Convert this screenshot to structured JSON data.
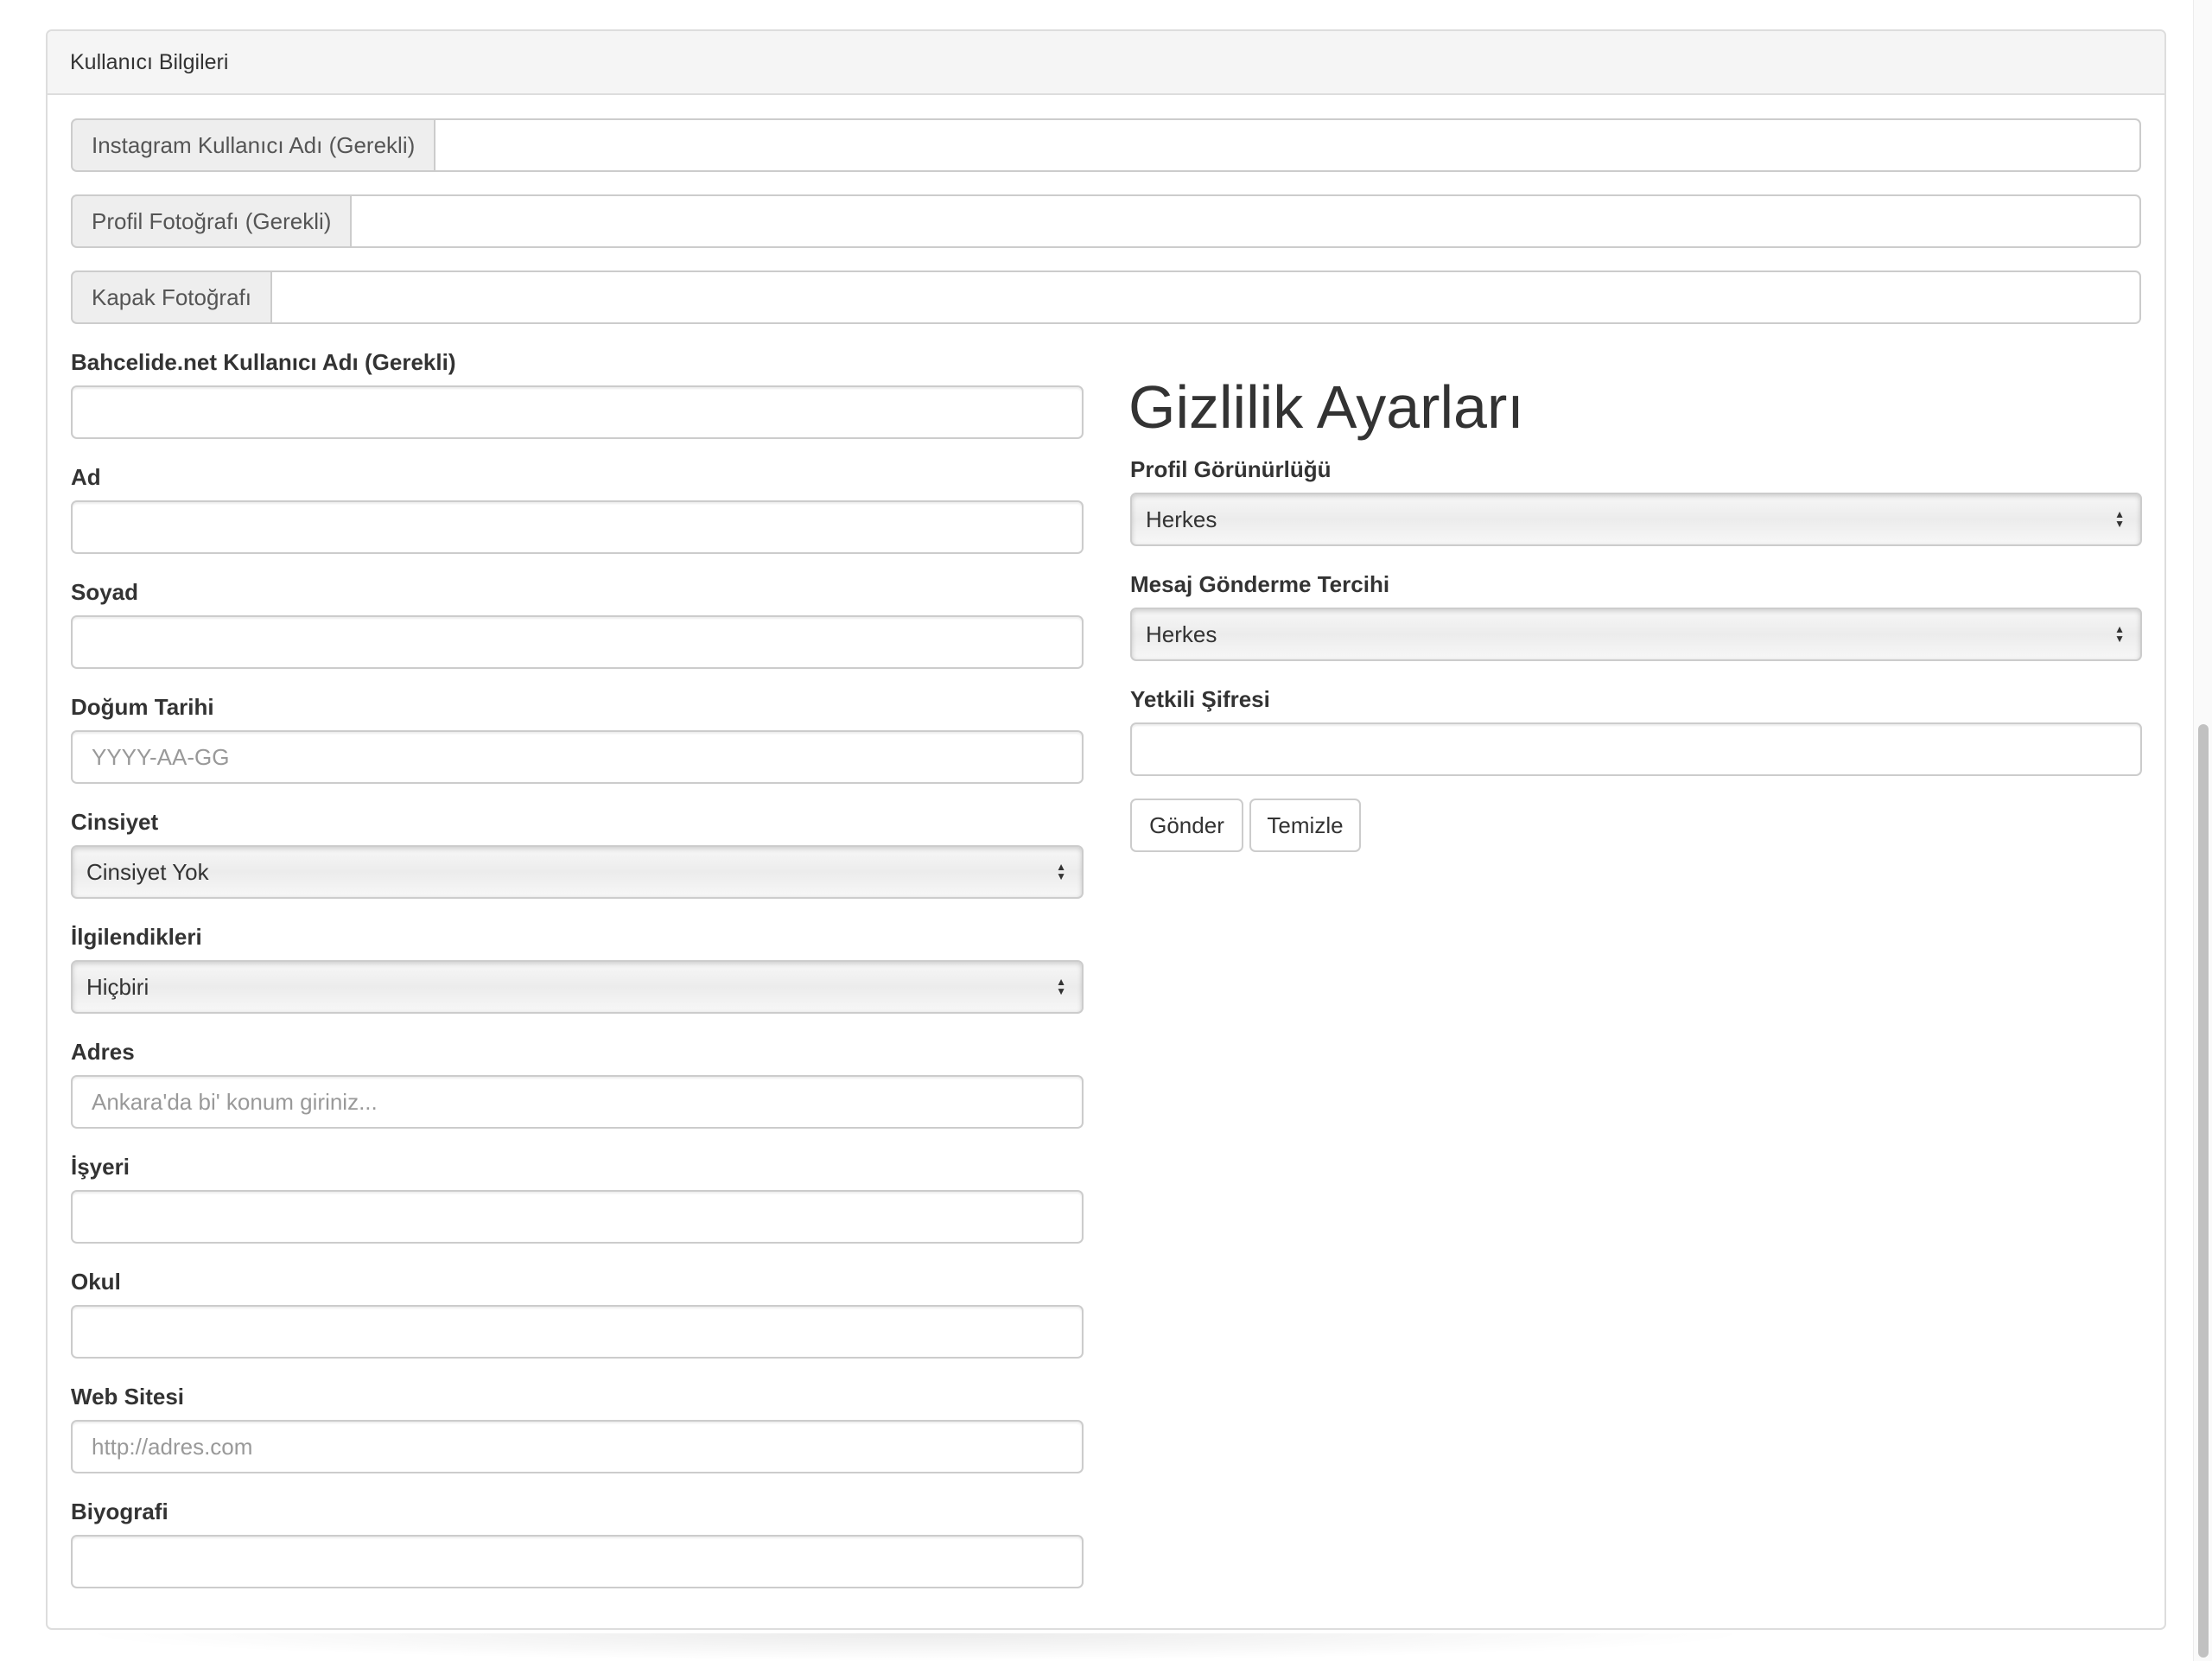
{
  "panel": {
    "title": "Kullanıcı Bilgileri"
  },
  "top_inputs": {
    "instagram_label": "Instagram Kullanıcı Adı (Gerekli)",
    "profile_photo_label": "Profil Fotoğrafı (Gerekli)",
    "cover_photo_label": "Kapak Fotoğrafı"
  },
  "left": {
    "username_label": "Bahcelide.net Kullanıcı Adı (Gerekli)",
    "first_name_label": "Ad",
    "last_name_label": "Soyad",
    "birth_label": "Doğum Tarihi",
    "birth_placeholder": "YYYY-AA-GG",
    "gender_label": "Cinsiyet",
    "gender_value": "Cinsiyet Yok",
    "interests_label": "İlgilendikleri",
    "interests_value": "Hiçbiri",
    "address_label": "Adres",
    "address_placeholder": "Ankara'da bi' konum giriniz...",
    "workplace_label": "İşyeri",
    "school_label": "Okul",
    "website_label": "Web Sitesi",
    "website_placeholder": "http://adres.com",
    "bio_label": "Biyografi"
  },
  "right": {
    "heading": "Gizlilik Ayarları",
    "visibility_label": "Profil Görünürlüğü",
    "visibility_value": "Herkes",
    "message_label": "Mesaj Gönderme Tercihi",
    "message_value": "Herkes",
    "password_label": "Yetkili Şifresi",
    "submit_label": "Gönder",
    "clear_label": "Temizle"
  }
}
